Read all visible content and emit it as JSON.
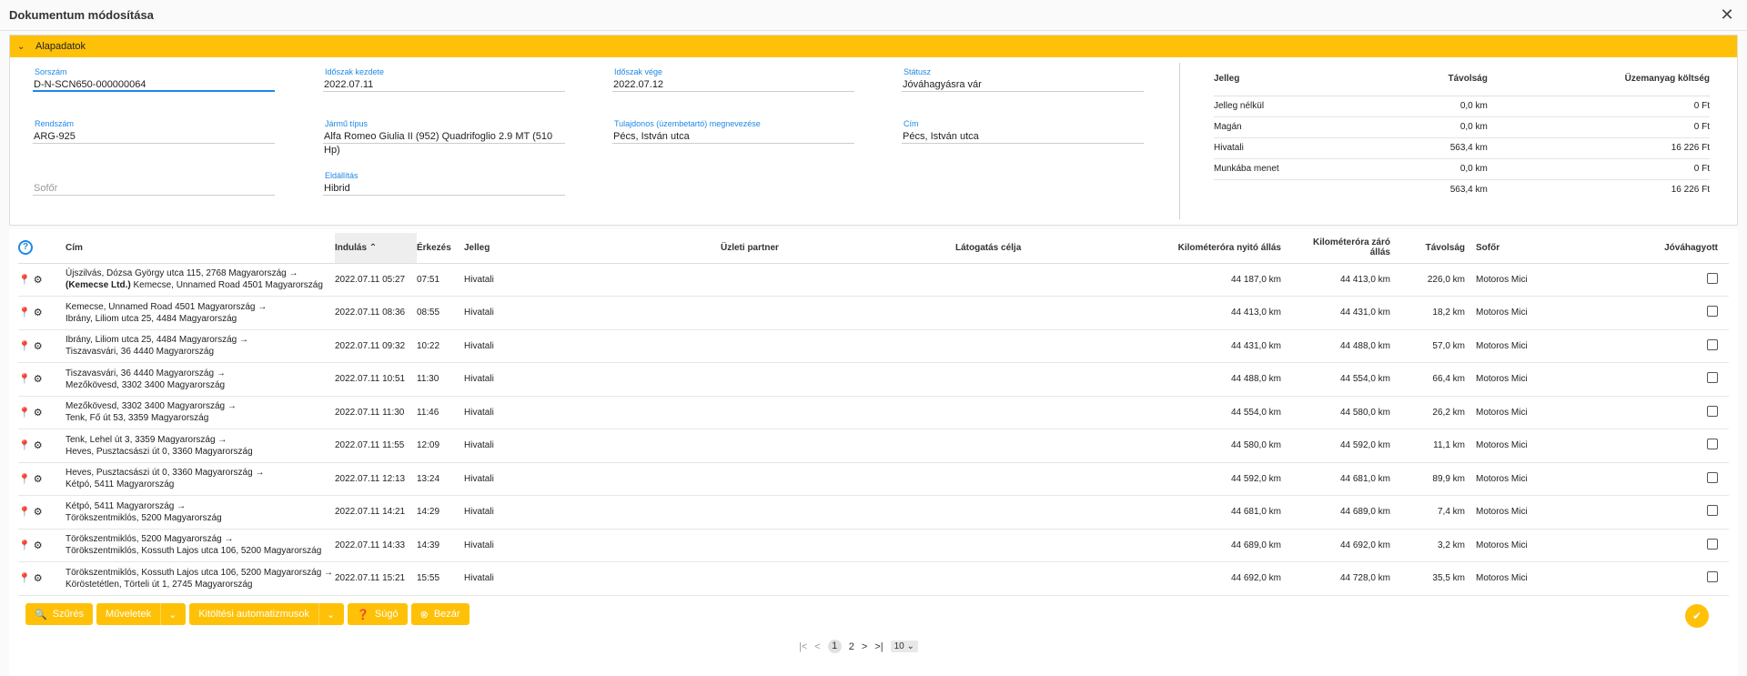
{
  "window": {
    "title": "Dokumentum módosítása"
  },
  "section": {
    "title": "Alapadatok"
  },
  "form": [
    {
      "label": "Sorszám",
      "value": "D-N-SCN650-000000064"
    },
    {
      "label": "Időszak kezdete",
      "value": "2022.07.11"
    },
    {
      "label": "Időszak vége",
      "value": "2022.07.12"
    },
    {
      "label": "Státusz",
      "value": "Jóváhagyásra vár"
    },
    {
      "label": "Rendszám",
      "value": "ARG-925"
    },
    {
      "label": "Jármű típus",
      "value": "Alfa Romeo Giulia II (952) Quadrifoglio 2.9 MT (510 Hp)"
    },
    {
      "label": "Tulajdonos (üzembetartó) megnevezése",
      "value": "Pécs, István utca"
    },
    {
      "label": "Cím",
      "value": "Pécs, István utca"
    },
    {
      "label": "",
      "placeholder": "Sofőr"
    },
    {
      "label": "Eldállítás",
      "value": "Hibrid"
    }
  ],
  "summary": {
    "headers": [
      "Jelleg",
      "Távolság",
      "Üzemanyag költség"
    ],
    "rows": [
      [
        "Jelleg nélkül",
        "0,0 km",
        "0 Ft"
      ],
      [
        "Magán",
        "0,0 km",
        "0 Ft"
      ],
      [
        "Hivatali",
        "563,4 km",
        "16 226 Ft"
      ],
      [
        "Munkába menet",
        "0,0 km",
        "0 Ft"
      ],
      [
        "",
        "563,4 km",
        "16 226 Ft"
      ]
    ]
  },
  "grid": {
    "help": "?",
    "headers": {
      "cim": "Cím",
      "indulas": "Indulás",
      "sort_arrow": "⌃",
      "erkezes": "Érkezés",
      "jelleg": "Jelleg",
      "partner": "Üzleti partner",
      "cel": "Látogatás célja",
      "km_nyito": "Kilométeróra nyitó állás",
      "km_zaro": "Kilométeróra záró állás",
      "tavolsag": "Távolság",
      "sofor": "Sofőr",
      "jovahagyott": "Jóváhagyott"
    },
    "rows": [
      {
        "line1": "Újszilvás, Dózsa György utca 115, 2768 Magyarország →",
        "line2_bold": "(Kemecse Ltd.)",
        "line2": " Kemecse, Unnamed Road 4501 Magyarország",
        "indulas": "2022.07.11 05:27",
        "erkezes": "07:51",
        "jelleg": "Hivatali",
        "partner": "",
        "cel": "",
        "km_nyito": "44 187,0 km",
        "km_zaro": "44 413,0 km",
        "tavolsag": "226,0 km",
        "sofor": "Motoros Mici"
      },
      {
        "line1": "Kemecse, Unnamed Road 4501 Magyarország →",
        "line2_bold": "",
        "line2": "Ibrány, Liliom utca 25, 4484 Magyarország",
        "indulas": "2022.07.11 08:36",
        "erkezes": "08:55",
        "jelleg": "Hivatali",
        "partner": "",
        "cel": "",
        "km_nyito": "44 413,0 km",
        "km_zaro": "44 431,0 km",
        "tavolsag": "18,2 km",
        "sofor": "Motoros Mici"
      },
      {
        "line1": "Ibrány, Liliom utca 25, 4484 Magyarország →",
        "line2_bold": "",
        "line2": "Tiszavasvári, 36 4440 Magyarország",
        "indulas": "2022.07.11 09:32",
        "erkezes": "10:22",
        "jelleg": "Hivatali",
        "partner": "",
        "cel": "",
        "km_nyito": "44 431,0 km",
        "km_zaro": "44 488,0 km",
        "tavolsag": "57,0 km",
        "sofor": "Motoros Mici"
      },
      {
        "line1": "Tiszavasvári, 36 4440 Magyarország →",
        "line2_bold": "",
        "line2": "Mezőkövesd, 3302 3400 Magyarország",
        "indulas": "2022.07.11 10:51",
        "erkezes": "11:30",
        "jelleg": "Hivatali",
        "partner": "",
        "cel": "",
        "km_nyito": "44 488,0 km",
        "km_zaro": "44 554,0 km",
        "tavolsag": "66,4 km",
        "sofor": "Motoros Mici"
      },
      {
        "line1": "Mezőkövesd, 3302 3400 Magyarország →",
        "line2_bold": "",
        "line2": "Tenk, Fő út 53, 3359 Magyarország",
        "indulas": "2022.07.11 11:30",
        "erkezes": "11:46",
        "jelleg": "Hivatali",
        "partner": "",
        "cel": "",
        "km_nyito": "44 554,0 km",
        "km_zaro": "44 580,0 km",
        "tavolsag": "26,2 km",
        "sofor": "Motoros Mici"
      },
      {
        "line1": "Tenk, Lehel út 3, 3359 Magyarország →",
        "line2_bold": "",
        "line2": "Heves, Pusztacsászi út 0, 3360 Magyarország",
        "indulas": "2022.07.11 11:55",
        "erkezes": "12:09",
        "jelleg": "Hivatali",
        "partner": "",
        "cel": "",
        "km_nyito": "44 580,0 km",
        "km_zaro": "44 592,0 km",
        "tavolsag": "11,1 km",
        "sofor": "Motoros Mici"
      },
      {
        "line1": "Heves, Pusztacsászi út 0, 3360 Magyarország →",
        "line2_bold": "",
        "line2": "Kétpó, 5411 Magyarország",
        "indulas": "2022.07.11 12:13",
        "erkezes": "13:24",
        "jelleg": "Hivatali",
        "partner": "",
        "cel": "",
        "km_nyito": "44 592,0 km",
        "km_zaro": "44 681,0 km",
        "tavolsag": "89,9 km",
        "sofor": "Motoros Mici"
      },
      {
        "line1": "Kétpó, 5411 Magyarország →",
        "line2_bold": "",
        "line2": "Törökszentmiklós, 5200 Magyarország",
        "indulas": "2022.07.11 14:21",
        "erkezes": "14:29",
        "jelleg": "Hivatali",
        "partner": "",
        "cel": "",
        "km_nyito": "44 681,0 km",
        "km_zaro": "44 689,0 km",
        "tavolsag": "7,4 km",
        "sofor": "Motoros Mici"
      },
      {
        "line1": "Törökszentmiklós, 5200 Magyarország →",
        "line2_bold": "",
        "line2": "Törökszentmiklós, Kossuth Lajos utca 106, 5200 Magyarország",
        "indulas": "2022.07.11 14:33",
        "erkezes": "14:39",
        "jelleg": "Hivatali",
        "partner": "",
        "cel": "",
        "km_nyito": "44 689,0 km",
        "km_zaro": "44 692,0 km",
        "tavolsag": "3,2 km",
        "sofor": "Motoros Mici"
      },
      {
        "line1": "Törökszentmiklós, Kossuth Lajos utca 106, 5200 Magyarország →",
        "line2_bold": "",
        "line2": "Köröstetétlen, Törteli út 1, 2745 Magyarország",
        "indulas": "2022.07.11 15:21",
        "erkezes": "15:55",
        "jelleg": "Hivatali",
        "partner": "",
        "cel": "",
        "km_nyito": "44 692,0 km",
        "km_zaro": "44 728,0 km",
        "tavolsag": "35,5 km",
        "sofor": "Motoros Mici"
      }
    ]
  },
  "toolbar": {
    "szures": "Szűrés",
    "muveletek": "Műveletek",
    "kitoltes": "Kitöltési automatizmusok",
    "sugo": "Súgó",
    "bezar": "Bezár"
  },
  "pager": {
    "pages": [
      "1",
      "2"
    ],
    "current": "1",
    "page_size": "10"
  },
  "colors": {
    "accent": "#ffc107",
    "label_blue": "#1e88e5"
  },
  "icons": [
    "close-icon",
    "chevron-down-icon",
    "help-icon",
    "map-pin-icon",
    "gear-icon",
    "search-icon",
    "question-icon",
    "cancel-icon",
    "double-check-icon",
    "first-page-icon",
    "prev-page-icon",
    "next-page-icon",
    "last-page-icon"
  ]
}
